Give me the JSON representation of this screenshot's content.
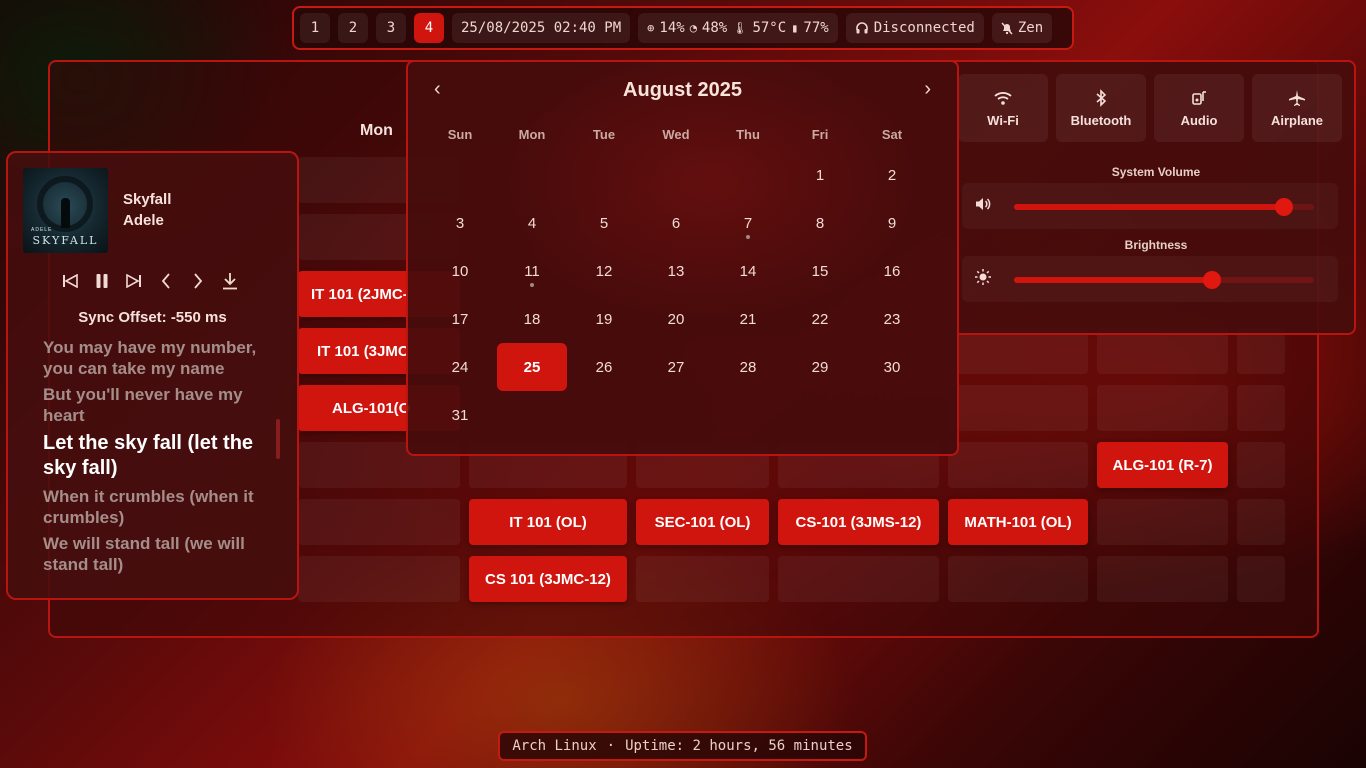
{
  "topbar": {
    "workspaces": [
      {
        "label": "1",
        "active": false
      },
      {
        "label": "2",
        "active": false
      },
      {
        "label": "3",
        "active": false
      },
      {
        "label": "4",
        "active": true
      }
    ],
    "datetime": "25/08/2025 02:40 PM",
    "cpu": "14%",
    "ram": "48%",
    "temp": "57°C",
    "battery": "77%",
    "headphones": "Disconnected",
    "notifications": "Zen"
  },
  "schedule": {
    "visible_day_header": "Mon",
    "classes": {
      "c1": "IT 101 (2JMC-",
      "c2": "IT 101 (3JMC",
      "c3": "ALG-101(O",
      "c4": "ALG-101 (R-7)",
      "c5": "IT 101 (OL)",
      "c6": "SEC-101 (OL)",
      "c7": "CS-101 (3JMS-12)",
      "c8": "MATH-101 (OL)",
      "c9": "CS 101 (3JMC-12)"
    }
  },
  "calendar": {
    "title": "August 2025",
    "prev": "‹",
    "next": "›",
    "weekdays": [
      "Sun",
      "Mon",
      "Tue",
      "Wed",
      "Thu",
      "Fri",
      "Sat"
    ],
    "weeks": [
      [
        "",
        "",
        "",
        "",
        "",
        "1",
        "2"
      ],
      [
        "3",
        "4",
        "5",
        "6",
        "7",
        "8",
        "9"
      ],
      [
        "10",
        "11",
        "12",
        "13",
        "14",
        "15",
        "16"
      ],
      [
        "17",
        "18",
        "19",
        "20",
        "21",
        "22",
        "23"
      ],
      [
        "24",
        "25",
        "26",
        "27",
        "28",
        "29",
        "30"
      ],
      [
        "31",
        "",
        "",
        "",
        "",
        "",
        ""
      ]
    ],
    "today": "25",
    "event_days": [
      "7",
      "11"
    ]
  },
  "quick_settings": {
    "tiles": [
      {
        "label": "Wi-Fi",
        "icon": "wifi-icon"
      },
      {
        "label": "Bluetooth",
        "icon": "bluetooth-icon"
      },
      {
        "label": "Audio",
        "icon": "audio-icon"
      },
      {
        "label": "Airplane",
        "icon": "airplane-icon"
      }
    ],
    "volume_label": "System Volume",
    "volume_level": 0.9,
    "brightness_label": "Brightness",
    "brightness_level": 0.66
  },
  "player": {
    "title": "Skyfall",
    "artist": "Adele",
    "cover_text": "SKYFALL",
    "cover_artist": "ADELE",
    "sync_offset": "Sync Offset: -550 ms",
    "lyrics": [
      {
        "text": "You may have my number, you can take my name",
        "current": false
      },
      {
        "text": "But you'll never have my heart",
        "current": false
      },
      {
        "text": "Let the sky fall (let the sky fall)",
        "current": true
      },
      {
        "text": "When it crumbles (when it crumbles)",
        "current": false
      },
      {
        "text": "We will stand tall (we will stand tall)",
        "current": false
      }
    ]
  },
  "bottombar": {
    "os": "Arch Linux",
    "separator": "·",
    "uptime": "Uptime: 2 hours, 56 minutes"
  },
  "colors": {
    "accent": "#d0150f",
    "border": "#b81510"
  }
}
